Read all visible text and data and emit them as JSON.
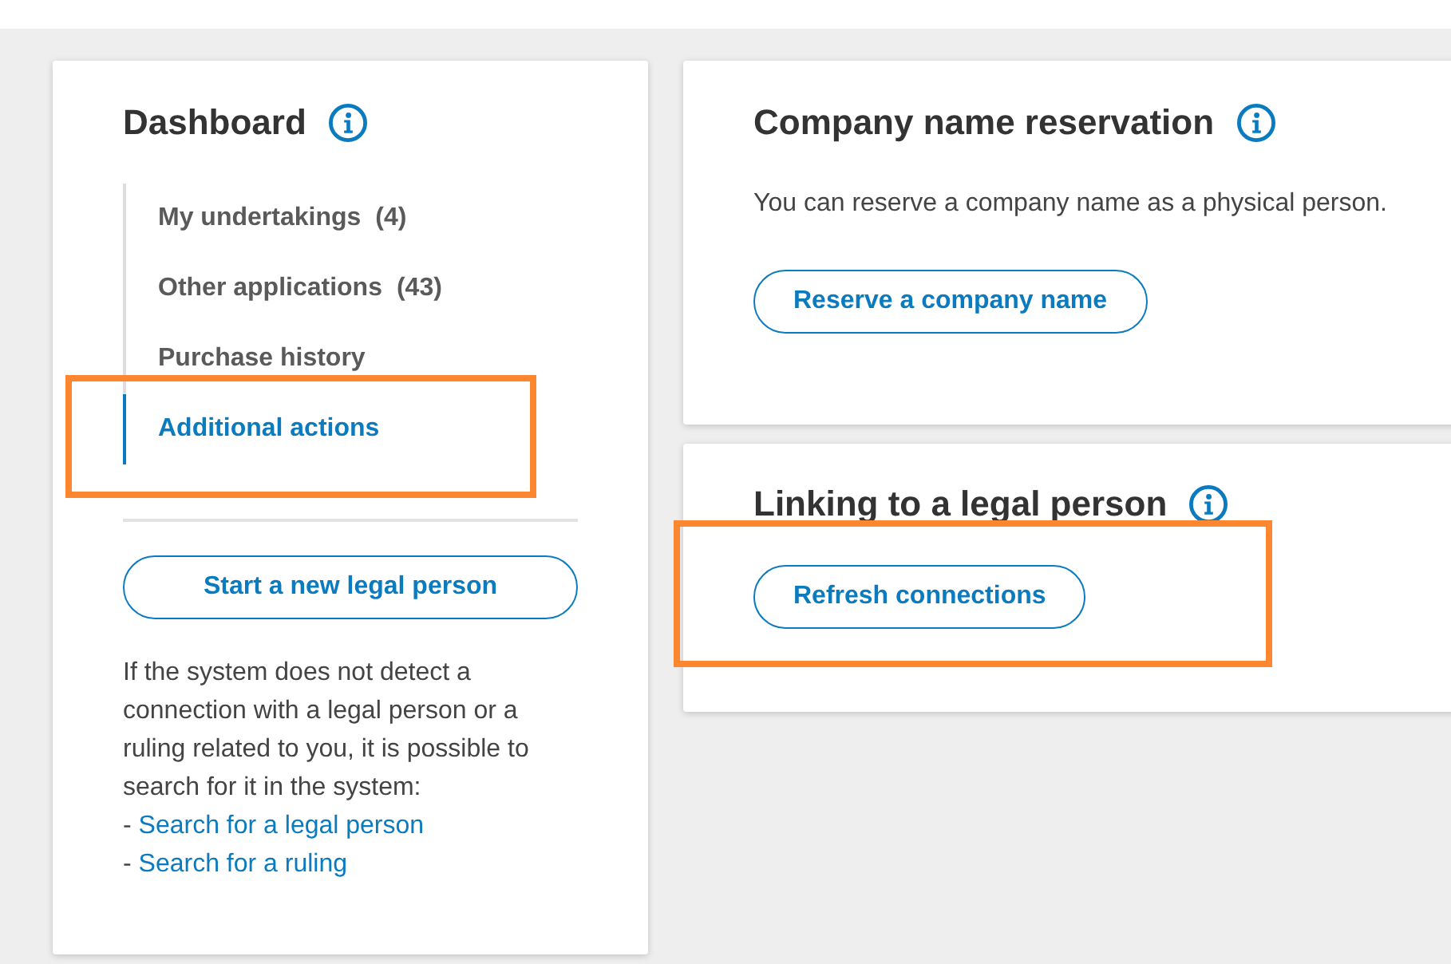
{
  "dashboard": {
    "title": "Dashboard",
    "nav": [
      {
        "label": "My undertakings",
        "count": "(4)",
        "selected": false,
        "highlighted": false
      },
      {
        "label": "Other applications",
        "count": "(43)",
        "selected": false,
        "highlighted": false
      },
      {
        "label": "Purchase history",
        "selected": false,
        "highlighted": false
      },
      {
        "label": "Additional actions",
        "selected": true,
        "highlighted": true
      }
    ],
    "new_button": "Start a new legal person",
    "help_text": "If the system does not detect a connection with a legal person or a ruling related to you, it is possible to search for it in the system:",
    "links": [
      {
        "marker": "-",
        "label": "Search for a legal person"
      },
      {
        "marker": "-",
        "label": "Search for a ruling"
      }
    ]
  },
  "cards": [
    {
      "title": "Company name reservation",
      "text": "You can reserve a company name as a physical person.",
      "button": "Reserve a company name",
      "highlighted": false
    },
    {
      "title": "Linking to a legal person",
      "button": "Refresh connections",
      "highlighted": true
    }
  ]
}
